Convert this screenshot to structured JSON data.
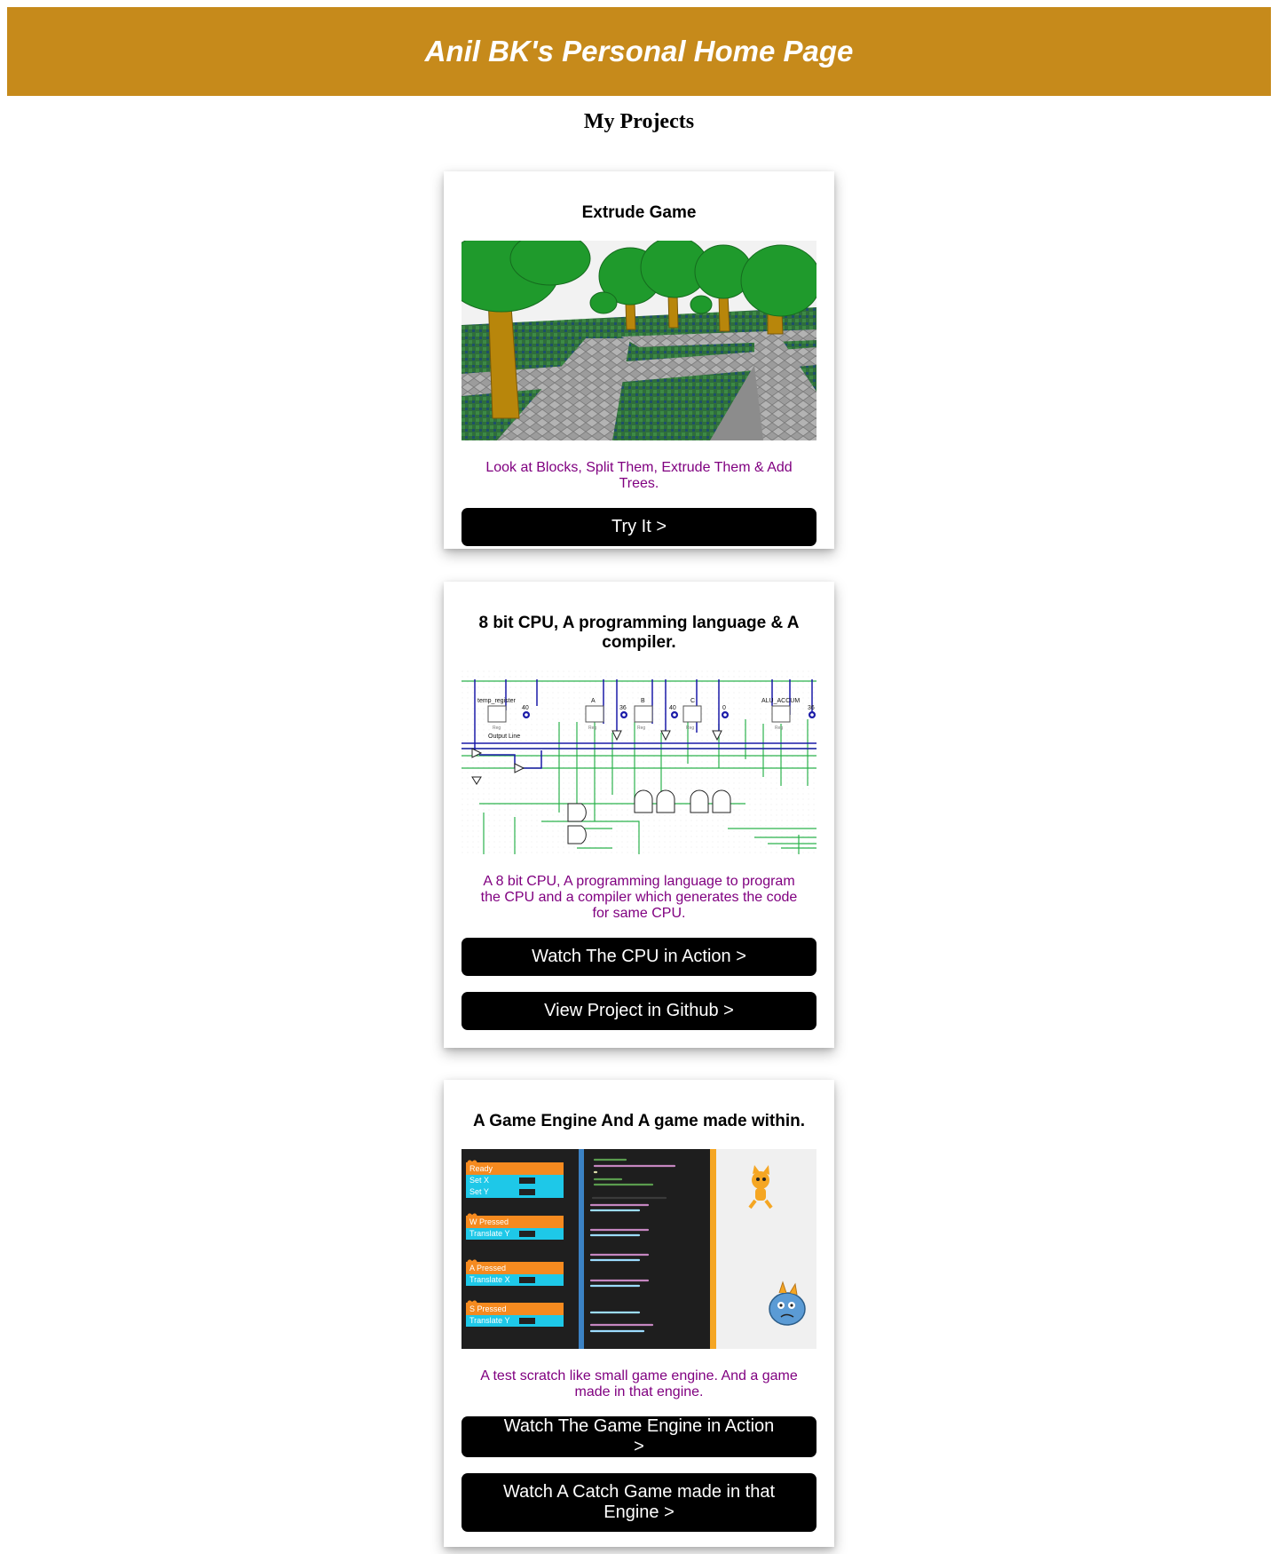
{
  "header": {
    "title": "Anil BK's Personal Home Page"
  },
  "section_title": "My Projects",
  "projects": [
    {
      "title": "Extrude Game",
      "image": "3D render of stone paths between grass blocks with trees",
      "description": "Look at Blocks, Split Them, Extrude Them & Add Trees.",
      "buttons": [
        "Try It >"
      ]
    },
    {
      "title": "8 bit CPU, A programming language & A compiler.",
      "image": "Logic circuit diagram of registers, buses and gates",
      "circuit_labels": {
        "temp_register": "temp_register",
        "output_line": "Output Line",
        "a": "A",
        "b": "B",
        "c": "C",
        "alu_accum": "ALU_ACCUM",
        "reg": "Reg",
        "v40": "40",
        "v36": "36",
        "v40b": "40",
        "v0": "0",
        "v36b": "36"
      },
      "description": "A 8 bit CPU, A programming language to program the CPU and a compiler which generates the code for same CPU.",
      "buttons": [
        "Watch The CPU in Action >",
        "View Project in Github >"
      ]
    },
    {
      "title": "A Game Engine And A game made within.",
      "image": "Block editor, code editor and sprite stage",
      "blocks": [
        {
          "event": "Ready",
          "actions": [
            "Set X",
            "Set Y"
          ]
        },
        {
          "event": "W Pressed",
          "actions": [
            "Translate Y"
          ]
        },
        {
          "event": "A Pressed",
          "actions": [
            "Translate X"
          ]
        },
        {
          "event": "S Pressed",
          "actions": [
            "Translate Y"
          ]
        }
      ],
      "description": "A test scratch like small game engine. And a game made in that engine.",
      "buttons": [
        "Watch The Game Engine in Action >",
        "Watch A Catch Game made in that Engine >"
      ]
    }
  ],
  "colors": {
    "header_bg": "#c68a1b",
    "description_text": "#800080",
    "button_bg": "#000000"
  }
}
